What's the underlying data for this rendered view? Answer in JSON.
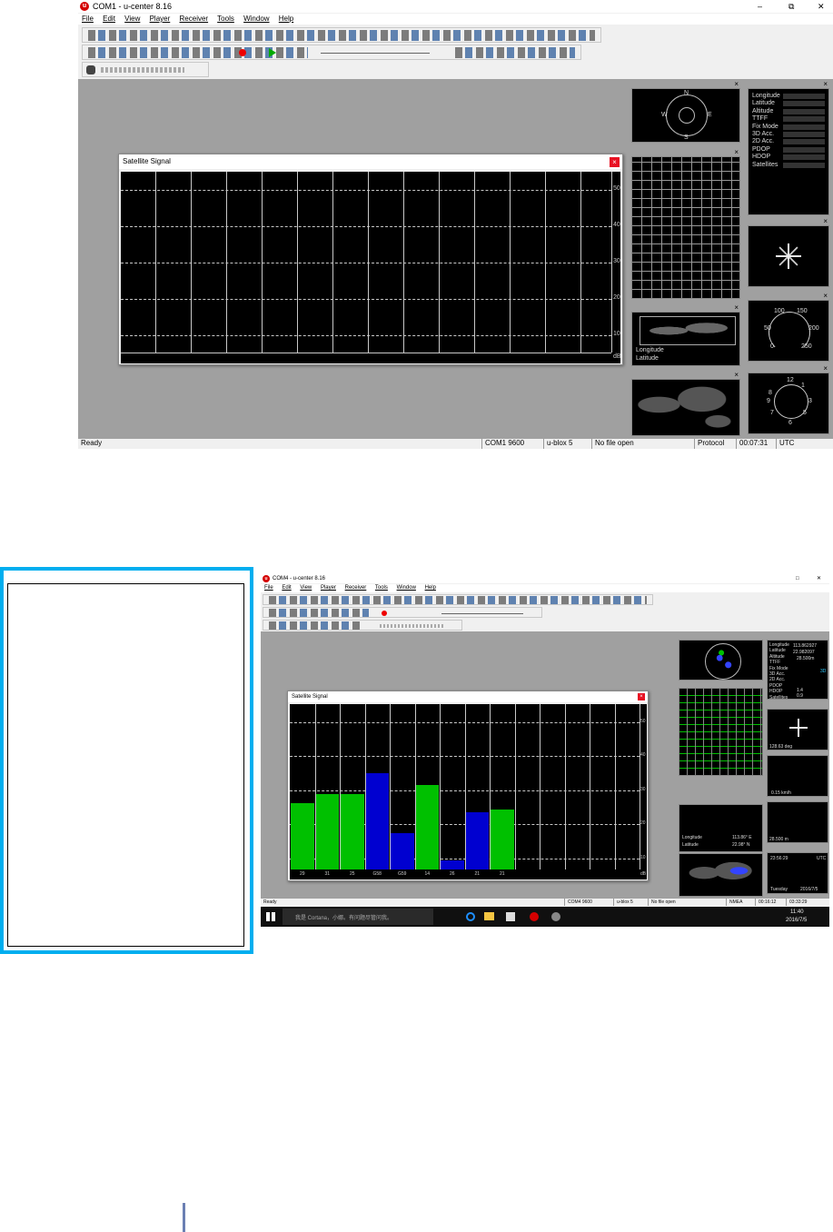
{
  "top_app": {
    "title": "COM1 - u-center 8.16",
    "menu": [
      "File",
      "Edit",
      "View",
      "Player",
      "Receiver",
      "Tools",
      "Window",
      "Help"
    ],
    "window_controls": [
      "–",
      "⧉",
      "✕"
    ],
    "satellite_window": {
      "title": "Satellite Signal",
      "y_ticks": [
        "50",
        "40",
        "30",
        "20",
        "10"
      ],
      "unit": "dB"
    },
    "compass": {
      "n": "N",
      "e": "E",
      "s": "S",
      "w": "W"
    },
    "info_labels": [
      "Longitude",
      "Latitude",
      "Altitude",
      "TTFF",
      "Fix Mode",
      "3D Acc.",
      "2D Acc.",
      "PDOP",
      "HDOP",
      "Satellites"
    ],
    "map_labels": [
      "Longitude",
      "Latitude"
    ],
    "speed_ticks": {
      "t1": "100",
      "t2": "150",
      "t3": "50",
      "t4": "200",
      "t5": "0",
      "t6": "250"
    },
    "clock_numbers": {
      "n12": "12",
      "n3": "3",
      "n6": "6",
      "n9": "9",
      "n1": "1",
      "n8": "8",
      "n7": "7",
      "n5": "5"
    },
    "status": {
      "ready": "Ready",
      "port": "COM1 9600",
      "receiver": "u-blox 5",
      "file": "No file open",
      "protocol": "Protocol",
      "time": "00:07:31",
      "tz": "UTC"
    }
  },
  "bottom_app": {
    "title": "COM4 - u-center 8.16",
    "menu": [
      "File",
      "Edit",
      "View",
      "Player",
      "Receiver",
      "Tools",
      "Window",
      "Help"
    ],
    "window_controls": [
      "□",
      "✕"
    ],
    "satellite_window": {
      "title": "Satellite Signal",
      "y_ticks": [
        "50",
        "40",
        "30",
        "20",
        "10"
      ],
      "unit": "dB"
    },
    "status": {
      "ready": "Ready",
      "port": "COM4 9600",
      "receiver": "u-blox 5",
      "file": "No file open",
      "protocol": "NMEA",
      "time1": "00:16:12",
      "time2": "03:33:29"
    },
    "info_values": {
      "longitude": "113.862927",
      "latitude": "22.982097",
      "altitude": "28.500m",
      "fix_mode": "3D",
      "pdop": "1.4",
      "hdop": "0.9"
    },
    "info_labels": [
      "Longitude",
      "Latitude",
      "Altitude",
      "TTFF",
      "Fix Mode",
      "3D Acc.",
      "2D Acc.",
      "PDOP",
      "HDOP",
      "Satellites"
    ],
    "compass_heading": "128.63 deg",
    "map_labels": [
      "Longitude",
      "Latitude"
    ],
    "map_values": [
      "113.86° E",
      "22.98° N"
    ],
    "clock_time": "23:56:29",
    "clock_tz": "UTC",
    "clock_day": "Tuesday",
    "clock_date": "2016/7/5",
    "speed_value": "0.15 km/h",
    "altitude_value": "28.500 m",
    "taskbar": {
      "search": "我是 Cortana，小娜。有问题尽管问我。",
      "clock_time": "11:40",
      "clock_date": "2016/7/5"
    }
  },
  "chart_data": {
    "type": "bar",
    "title": "Satellite Signal",
    "ylabel": "dB",
    "ylim": [
      0,
      55
    ],
    "categories": [
      "29",
      "31",
      "25",
      "G58",
      "G59",
      "14",
      "26",
      "21",
      "21"
    ],
    "values": [
      22,
      25,
      25,
      32,
      12,
      28,
      3,
      19,
      20
    ],
    "colors": [
      "#00c000",
      "#00c000",
      "#00c000",
      "#0000d0",
      "#0000d0",
      "#00c000",
      "#0000d0",
      "#0000d0",
      "#00c000"
    ]
  }
}
